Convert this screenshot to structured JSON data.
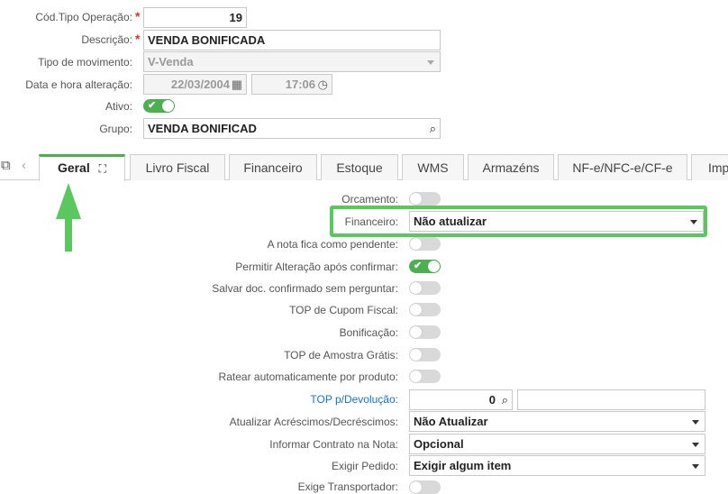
{
  "header_form": {
    "cod_tipo_label": "Cód.Tipo Operação:",
    "cod_tipo_value": "19",
    "descricao_label": "Descrição:",
    "descricao_value": "VENDA BONIFICADA",
    "tipo_mov_label": "Tipo de movimento:",
    "tipo_mov_value": "V-Venda",
    "data_label": "Data e hora alteração:",
    "data_value": "22/03/2004",
    "hora_value": "17:06",
    "ativo_label": "Ativo:",
    "grupo_label": "Grupo:",
    "grupo_value": "VENDA BONIFICAD"
  },
  "tabs": [
    {
      "label": "Geral"
    },
    {
      "label": "Livro Fiscal"
    },
    {
      "label": "Financeiro"
    },
    {
      "label": "Estoque"
    },
    {
      "label": "WMS"
    },
    {
      "label": "Armazéns"
    },
    {
      "label": "NF-e/NFC-e/CF-e"
    },
    {
      "label": "Imp"
    }
  ],
  "geral": {
    "orcamento_label": "Orcamento:",
    "financeiro_label": "Financeiro:",
    "financeiro_value": "Não atualizar",
    "nota_pendente_label": "A nota fica como pendente:",
    "permitir_alt_label": "Permitir Alteração após confirmar:",
    "salvar_doc_label": "Salvar doc. confirmado sem perguntar:",
    "top_cupom_label": "TOP de Cupom Fiscal:",
    "bonificacao_label": "Bonificação:",
    "top_amostra_label": "TOP de Amostra Grátis:",
    "ratear_label": "Ratear automaticamente por produto:",
    "top_devolucao_label": "TOP p/Devolução:",
    "top_devolucao_value": "0",
    "atualizar_acr_label": "Atualizar Acréscimos/Decréscimos:",
    "atualizar_acr_value": "Não Atualizar",
    "informar_contrato_label": "Informar Contrato na Nota:",
    "informar_contrato_value": "Opcional",
    "exigir_pedido_label": "Exigir Pedido:",
    "exigir_pedido_value": "Exigir algum item",
    "exige_transportador_label": "Exige Transportador:"
  },
  "colors": {
    "accent": "#4caf50",
    "highlight": "#5ac85e",
    "link": "#1a73c8",
    "required": "#d9342b"
  }
}
